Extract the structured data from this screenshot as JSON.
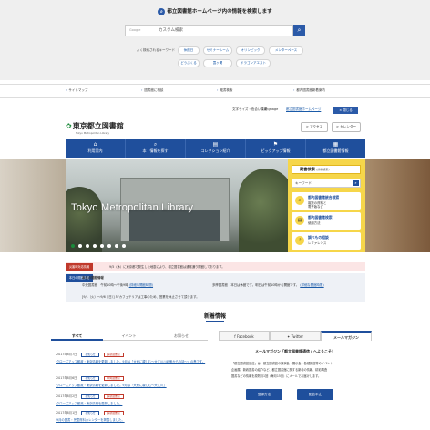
{
  "search": {
    "title": "都立図書館ホームページ内の情報を検索します",
    "box_label": "Google",
    "placeholder": "カスタム検索",
    "button_icon": "search-icon",
    "keywords_label": "よく検索されるキーワード",
    "keywords": [
      "休館日",
      "セミナールーム",
      "オリンピック",
      "メンターペース",
      "どうぶくる",
      "霞ヶ関",
      "ドラゴンアエスト"
    ]
  },
  "util_links": [
    "サイトマップ",
    "図書館に相談",
    "蔵書検索",
    "都内図書館新着案内"
  ],
  "header": {
    "text_size": "文字サイズ・色合い変更",
    "language": "Language",
    "mobile": "都立図書館ホームページ",
    "close": "× 閉じる",
    "logo": "東京都立図書館",
    "logo_en": "Tokyo Metropolitan Library",
    "access": "> アクセス",
    "calendar": "> カレンダー"
  },
  "nav": [
    "利用案内",
    "本・情報を探す",
    "コレクション紹介",
    "ピックアップ情報",
    "都立図書館情報"
  ],
  "hero": {
    "text": "Tokyo Metropolitan Library"
  },
  "panel": {
    "title": "蔵書検索",
    "title_sub": "(詳細検索)",
    "keyword": "キーワード",
    "buttons": [
      {
        "line1": "都内図書館統合検索",
        "line2": "複数の資料と",
        "line3": "電子版など",
        "icon": "search-icon"
      },
      {
        "line1": "都内図書館検索",
        "line2": "使用方法",
        "line3": "",
        "icon": "book-icon"
      },
      {
        "line1": "調べもの相談",
        "line2": "レファレンス",
        "line3": "",
        "icon": "bell-icon"
      }
    ]
  },
  "notices": {
    "tag1": "災害時対応情報",
    "text1": "9/5（木）に東京都で発生した地震により、都立図書館は通常通り開館しております。",
    "tag2": "本日の開館情報",
    "lines": [
      {
        "text": "本日の開館情報",
        "link": ""
      },
      {
        "text": "中央図書館　午前10時〜午後9時",
        "link": "(詳細な開館時間)"
      },
      {
        "text": "多摩図書館　本日は休館です。明日は午前10時から開館です。",
        "link": "(詳細な開館時間)"
      },
      {
        "text": "[9/1（火）〜9/6（日）] 5Fカフェテリアは工事のため、営業を休止させて頂きます。",
        "link": ""
      }
    ]
  },
  "news": {
    "title": "新着情報",
    "tabs": [
      "すべて",
      "イベント",
      "お知らせ"
    ],
    "items": [
      {
        "date": "2017年8月7日",
        "tag": "お知らせ",
        "tag2": "多摩図書館",
        "text": "クローズアップ都政・東京情報を更新しました。9月は「大東に親しむ〜大江川川北側からの話〜」の巻です。"
      },
      {
        "date": "2017年8月6日",
        "tag": "お知らせ",
        "tag2": "中央図書館",
        "text": "クローズアップ都政・東京情報を更新しました。9月は「大東に親しむ〜大江川」"
      },
      {
        "date": "2017年8月2日",
        "tag": "お知らせ",
        "tag2": "多摩図書館",
        "text": "クローズアップ都政・東京情報を更新しました。"
      },
      {
        "date": "2017年8月1日",
        "tag": "お知らせ",
        "tag2": "多摩図書館",
        "text": "9月の図書・児童資料カレンダーを掲載しました。"
      }
    ]
  },
  "right_tabs": [
    "Facebook",
    "Twitter",
    "メールマガジン"
  ],
  "mailmag": {
    "title": "メールマガジン「都立図書館通信」へようこそ！",
    "lines": [
      "「都立図書館通信」は、都立図書館の講演会・展示会・各種講座等のイベント",
      "企画展、新着図書の紹介など、都立図書館に関する新着の情報、精彩調査",
      "図書などの情報を原則月1回（毎月15日）にメールでお届けします。"
    ],
    "subscribe": "登録方法",
    "unsubscribe": "配信中止"
  },
  "colors": {
    "primary": "#1f4f9c",
    "panel": "#f6d64a",
    "alert": "#c0392b",
    "logo": "#1b8a3a"
  }
}
